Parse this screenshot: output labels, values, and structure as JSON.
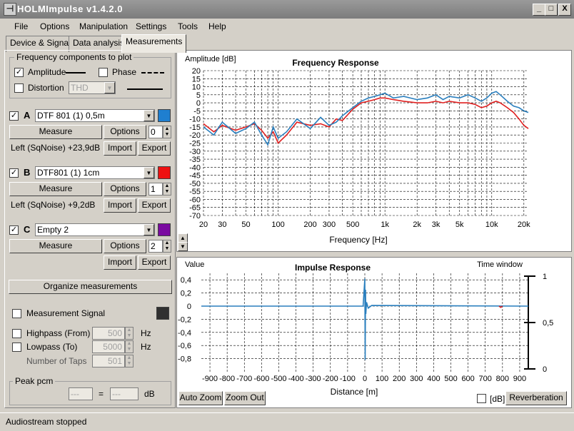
{
  "window": {
    "title": "HOLMImpulse  v1.4.2.0",
    "controls": [
      "_",
      "□",
      "X"
    ]
  },
  "menu": [
    "File",
    "Options",
    "Manipulation",
    "Settings",
    "Tools",
    "Help"
  ],
  "tabs": [
    "Device & Signal",
    "Data analysis",
    "Measurements"
  ],
  "freq_group": {
    "title": "Frequency components to plot",
    "amplitude_label": "Amplitude",
    "amplitude_checked": true,
    "phase_label": "Phase",
    "phase_checked": false,
    "distortion_label": "Distortion",
    "distortion_checked": false,
    "distortion_value": "THD"
  },
  "measurements": [
    {
      "letter": "A",
      "name": "DTF 801 (1) 0,5m",
      "checked": true,
      "color": "#1f7fd0",
      "measure": "Measure",
      "options": "Options",
      "spin": "0",
      "info": "Left (SqNoise) +23,9dB",
      "import": "Import",
      "export": "Export"
    },
    {
      "letter": "B",
      "name": "DTF801 (1) 1cm",
      "checked": true,
      "color": "#ee1111",
      "measure": "Measure",
      "options": "Options",
      "spin": "1",
      "info": "Left (SqNoise) +9,2dB",
      "import": "Import",
      "export": "Export"
    },
    {
      "letter": "C",
      "name": "Empty 2",
      "checked": true,
      "color": "#7a0aa0",
      "measure": "Measure",
      "options": "Options",
      "spin": "2",
      "info": "",
      "import": "Import",
      "export": "Export"
    }
  ],
  "organize_button": "Organize measurements",
  "signal_group": {
    "title": "Measurement Signal",
    "swatch": "#303030",
    "highpass_label": "Highpass (From)",
    "highpass_value": "500",
    "highpass_unit": "Hz",
    "lowpass_label": "Lowpass (To)",
    "lowpass_value": "5000",
    "lowpass_unit": "Hz",
    "taps_label": "Number of Taps",
    "taps_value": "501"
  },
  "peak_group": {
    "title": "Peak pcm",
    "field1": "---",
    "eq": "=",
    "field2": "---",
    "unit": "dB"
  },
  "freq_buttons": {
    "up": "▲",
    "down": "▼"
  },
  "impulse_buttons": {
    "auto_zoom": "Auto Zoom",
    "zoom_out": "Zoom Out",
    "db_label": "[dB]",
    "reverberation": "Reverberation"
  },
  "status": {
    "text": "Audiostream stopped"
  },
  "chart_data": [
    {
      "type": "line",
      "title": "Frequency Response",
      "ylabel": "Amplitude [dB]",
      "xlabel": "Frequency [Hz]",
      "xscale": "log",
      "xlim": [
        20,
        22000
      ],
      "ylim": [
        -70,
        20
      ],
      "xticks": [
        20,
        30,
        50,
        100,
        200,
        300,
        500,
        1000,
        2000,
        3000,
        5000,
        10000,
        20000
      ],
      "xtick_labels": [
        "20",
        "30",
        "50",
        "100",
        "200",
        "300",
        "500",
        "1k",
        "2k",
        "3k",
        "5k",
        "10k",
        "20k"
      ],
      "yticks": [
        20,
        15,
        10,
        5,
        0,
        -5,
        -10,
        -15,
        -20,
        -25,
        -30,
        -35,
        -40,
        -45,
        -50,
        -55,
        -60,
        -65,
        -70
      ],
      "grid": true,
      "series": [
        {
          "color": "#e02020",
          "x": [
            20,
            25,
            30,
            40,
            50,
            60,
            70,
            80,
            90,
            100,
            120,
            150,
            200,
            250,
            300,
            350,
            400,
            500,
            600,
            700,
            800,
            900,
            1000,
            1200,
            1500,
            2000,
            2500,
            3000,
            3500,
            4000,
            5000,
            6000,
            7000,
            8000,
            9000,
            10000,
            11000,
            12000,
            14000,
            16000,
            18000,
            20000,
            22000
          ],
          "y": [
            -13,
            -18,
            -14,
            -17,
            -15,
            -13,
            -17,
            -22,
            -18,
            -25,
            -20,
            -12,
            -14,
            -13,
            -15,
            -10,
            -11,
            -4,
            0,
            1,
            2,
            3,
            3,
            2,
            1,
            0,
            0,
            1,
            0,
            1,
            0,
            0,
            -1,
            -3,
            -2,
            0,
            1,
            0,
            -3,
            -6,
            -10,
            -14,
            -16
          ]
        },
        {
          "color": "#2a7fbe",
          "x": [
            20,
            25,
            30,
            40,
            50,
            60,
            70,
            80,
            90,
            100,
            120,
            150,
            200,
            250,
            300,
            350,
            400,
            500,
            600,
            700,
            800,
            900,
            1000,
            1200,
            1500,
            2000,
            2500,
            3000,
            3500,
            4000,
            5000,
            6000,
            7000,
            8000,
            9000,
            10000,
            11000,
            12000,
            14000,
            16000,
            18000,
            20000,
            22000
          ],
          "y": [
            -15,
            -20,
            -12,
            -19,
            -16,
            -12,
            -20,
            -26,
            -15,
            -22,
            -18,
            -10,
            -16,
            -9,
            -14,
            -12,
            -8,
            -3,
            1,
            3,
            4,
            5,
            6,
            3,
            4,
            2,
            3,
            5,
            2,
            4,
            3,
            5,
            3,
            1,
            3,
            6,
            7,
            5,
            1,
            -2,
            -3,
            -5,
            -6
          ]
        }
      ]
    },
    {
      "type": "line",
      "title": "Impulse Response",
      "ylabel": "Value",
      "xlabel": "Distance [m]",
      "xlim": [
        -950,
        950
      ],
      "ylim": [
        -1,
        0.5
      ],
      "xticks": [
        -900,
        -800,
        -700,
        -600,
        -500,
        -400,
        -300,
        -200,
        -100,
        0,
        100,
        200,
        300,
        400,
        500,
        600,
        700,
        800,
        900
      ],
      "yticks": [
        0.4,
        0.2,
        0,
        -0.2,
        -0.4,
        -0.6,
        -0.8
      ],
      "right_axis": {
        "label": "Time window",
        "ticks": [
          "1",
          "0,5",
          "0"
        ]
      },
      "grid": true,
      "series": [
        {
          "color": "#2a7fbe",
          "x": [
            -950,
            -10,
            0,
            2,
            4,
            6,
            10,
            20,
            40,
            950
          ],
          "y": [
            0,
            0,
            0.42,
            -0.82,
            0.25,
            -0.12,
            0.06,
            -0.03,
            0.01,
            0
          ]
        },
        {
          "color": "#e02020",
          "x": [
            780,
            790,
            800
          ],
          "y": [
            0,
            -0.02,
            0
          ]
        }
      ]
    }
  ]
}
